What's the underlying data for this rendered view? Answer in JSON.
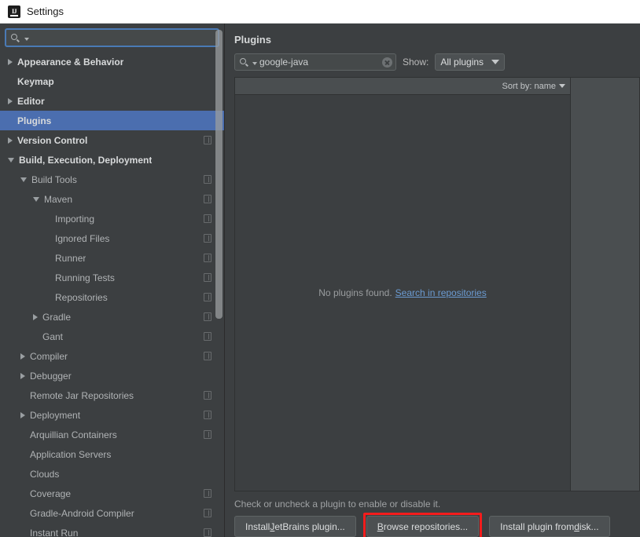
{
  "window": {
    "title": "Settings",
    "icon": "intellij-idea-icon"
  },
  "sidebar": {
    "search": {
      "value": "",
      "placeholder": ""
    },
    "items": [
      {
        "label": "Appearance & Behavior",
        "indent": 0,
        "twisty": "collapsed",
        "top": true,
        "scope": false,
        "selected": false
      },
      {
        "label": "Keymap",
        "indent": 0,
        "twisty": "none",
        "top": true,
        "scope": false,
        "selected": false
      },
      {
        "label": "Editor",
        "indent": 0,
        "twisty": "collapsed",
        "top": true,
        "scope": false,
        "selected": false
      },
      {
        "label": "Plugins",
        "indent": 0,
        "twisty": "none",
        "top": true,
        "scope": false,
        "selected": true
      },
      {
        "label": "Version Control",
        "indent": 0,
        "twisty": "collapsed",
        "top": true,
        "scope": true,
        "selected": false
      },
      {
        "label": "Build, Execution, Deployment",
        "indent": 0,
        "twisty": "expanded",
        "top": true,
        "scope": false,
        "selected": false
      },
      {
        "label": "Build Tools",
        "indent": 1,
        "twisty": "expanded",
        "top": false,
        "scope": true,
        "selected": false
      },
      {
        "label": "Maven",
        "indent": 2,
        "twisty": "expanded",
        "top": false,
        "scope": true,
        "selected": false
      },
      {
        "label": "Importing",
        "indent": 3,
        "twisty": "none",
        "top": false,
        "scope": true,
        "selected": false
      },
      {
        "label": "Ignored Files",
        "indent": 3,
        "twisty": "none",
        "top": false,
        "scope": true,
        "selected": false
      },
      {
        "label": "Runner",
        "indent": 3,
        "twisty": "none",
        "top": false,
        "scope": true,
        "selected": false
      },
      {
        "label": "Running Tests",
        "indent": 3,
        "twisty": "none",
        "top": false,
        "scope": true,
        "selected": false
      },
      {
        "label": "Repositories",
        "indent": 3,
        "twisty": "none",
        "top": false,
        "scope": true,
        "selected": false
      },
      {
        "label": "Gradle",
        "indent": 2,
        "twisty": "collapsed",
        "top": false,
        "scope": true,
        "selected": false
      },
      {
        "label": "Gant",
        "indent": 2,
        "twisty": "none",
        "top": false,
        "scope": true,
        "selected": false
      },
      {
        "label": "Compiler",
        "indent": 1,
        "twisty": "collapsed",
        "top": false,
        "scope": true,
        "selected": false
      },
      {
        "label": "Debugger",
        "indent": 1,
        "twisty": "collapsed",
        "top": false,
        "scope": false,
        "selected": false
      },
      {
        "label": "Remote Jar Repositories",
        "indent": 1,
        "twisty": "none",
        "top": false,
        "scope": true,
        "selected": false
      },
      {
        "label": "Deployment",
        "indent": 1,
        "twisty": "collapsed",
        "top": false,
        "scope": true,
        "selected": false
      },
      {
        "label": "Arquillian Containers",
        "indent": 1,
        "twisty": "none",
        "top": false,
        "scope": true,
        "selected": false
      },
      {
        "label": "Application Servers",
        "indent": 1,
        "twisty": "none",
        "top": false,
        "scope": false,
        "selected": false
      },
      {
        "label": "Clouds",
        "indent": 1,
        "twisty": "none",
        "top": false,
        "scope": false,
        "selected": false
      },
      {
        "label": "Coverage",
        "indent": 1,
        "twisty": "none",
        "top": false,
        "scope": true,
        "selected": false
      },
      {
        "label": "Gradle-Android Compiler",
        "indent": 1,
        "twisty": "none",
        "top": false,
        "scope": true,
        "selected": false
      },
      {
        "label": "Instant Run",
        "indent": 1,
        "twisty": "none",
        "top": false,
        "scope": true,
        "selected": false
      }
    ]
  },
  "main": {
    "title": "Plugins",
    "search": {
      "value": "google-java",
      "placeholder": ""
    },
    "show_label": "Show:",
    "show_value": "All plugins",
    "sort_label": "Sort by: name",
    "empty_text": "No plugins found.",
    "empty_link": "Search in repositories",
    "hint": "Check or uncheck a plugin to enable or disable it.",
    "buttons": [
      {
        "pre": "Install ",
        "mnem": "J",
        "post": "etBrains plugin...",
        "highlighted": false
      },
      {
        "pre": "",
        "mnem": "B",
        "post": "rowse repositories...",
        "highlighted": true
      },
      {
        "pre": "Install plugin from ",
        "mnem": "d",
        "post": "isk...",
        "highlighted": false
      }
    ]
  },
  "colors": {
    "accent_selection": "#4b6eaf",
    "panel_bg": "#3c3f41",
    "link": "#6b9bd2",
    "highlight_box": "#f41c1c"
  }
}
